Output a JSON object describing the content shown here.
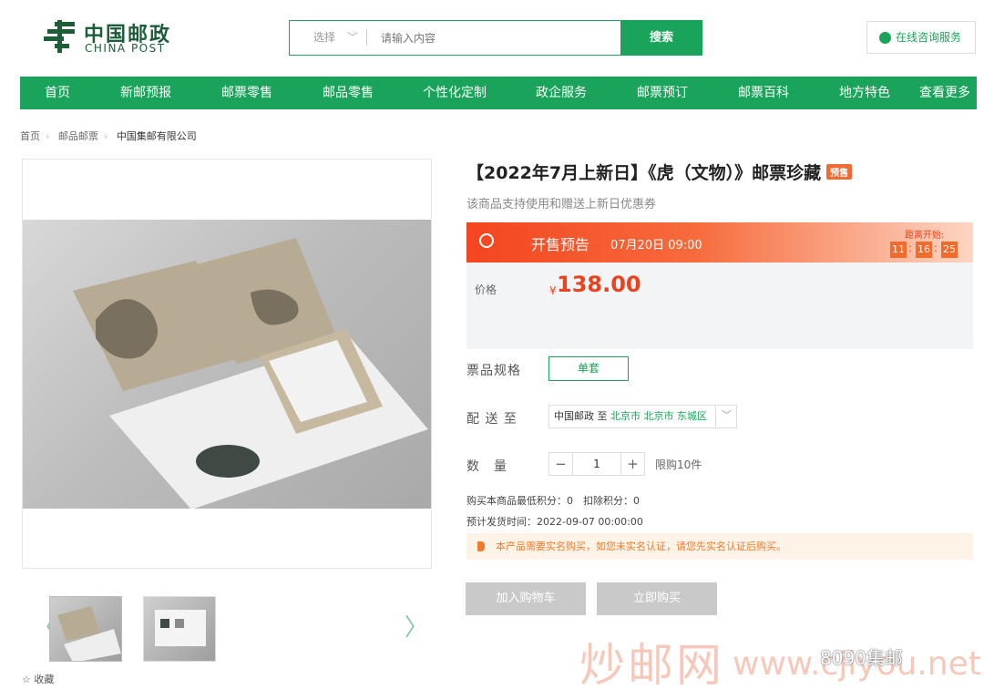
{
  "header": {
    "logo_cn": "中国邮政",
    "logo_en": "CHINA POST",
    "search": {
      "select_label": "选择",
      "placeholder": "请输入内容",
      "button": "搜索"
    },
    "consult": "在线咨询服务"
  },
  "nav": [
    "首页",
    "新邮预报",
    "邮票零售",
    "邮品零售",
    "个性化定制",
    "政企服务",
    "邮票预订",
    "邮票百科",
    "地方特色",
    "查看更多"
  ],
  "breadcrumb": [
    "首页",
    "邮品邮票",
    "中国集邮有限公司"
  ],
  "gallery": {
    "favorite": "收藏",
    "thumbnails": 2
  },
  "product": {
    "title": "【2022年7月上新日】《虎（文物）》邮票珍藏",
    "tag": "预售",
    "subtitle": "该商品支持使用和赠送上新日优惠券",
    "presale": {
      "label": "开售预告",
      "time": "07月20日 09:00",
      "countdown_label": "距离开始:",
      "countdown": [
        "11",
        "16",
        "25"
      ]
    },
    "price_label": "价格",
    "currency": "¥",
    "price": "138.00",
    "spec_label": "票品规格",
    "spec_option": "单套",
    "ship_label": "配 送 至",
    "ship_from": "中国邮政 至",
    "ship_to": "北京市 北京市 东城区",
    "qty_label": "数　量",
    "qty": "1",
    "limit": "限购10件",
    "points": "购买本商品最低积分：0　扣除积分：0",
    "ship_time": "预计发货时间：2022-09-07 00:00:00",
    "notice": "本产品需要实名购买，如您未实名认证，请您先实名认证后购买。",
    "add_cart": "加入购物车",
    "buy_now": "立即购买"
  },
  "watermark": {
    "cn": "炒邮网",
    "url": "www.cjiyou.net",
    "account": "8090集邮"
  },
  "colors": {
    "brand_green": "#1aa35a",
    "price_red": "#e8441f",
    "presale_orange": "#f4451f"
  }
}
